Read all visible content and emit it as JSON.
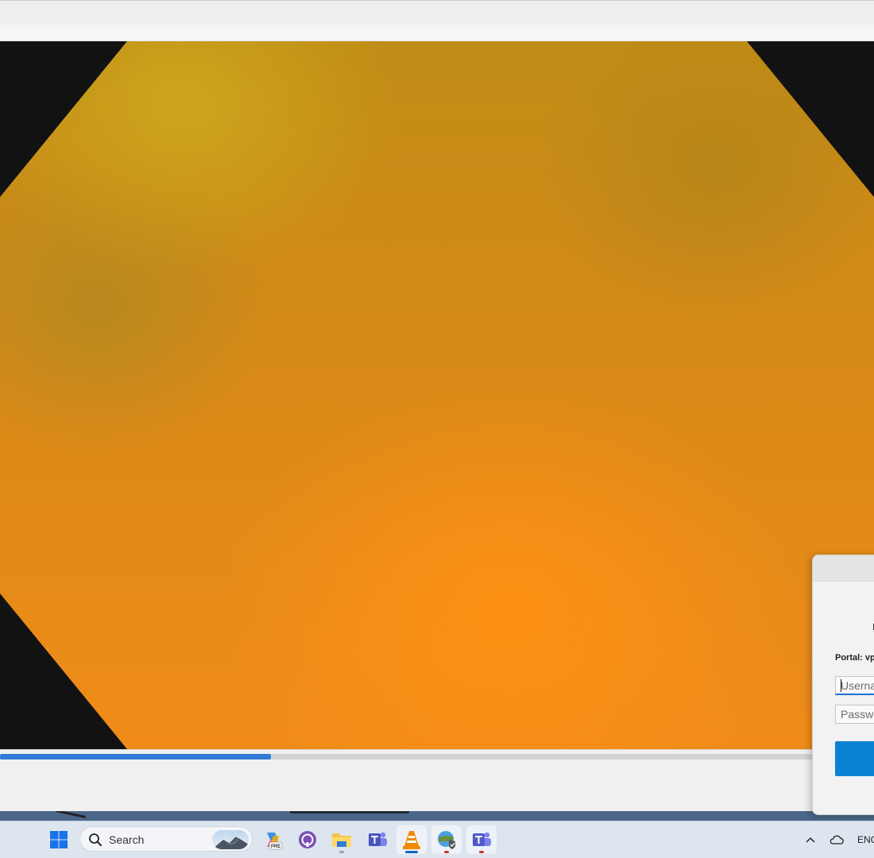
{
  "taskbar": {
    "search_label": "Search",
    "pinned": [
      {
        "name": "copilot",
        "badge": "PRE"
      },
      {
        "name": "github-desktop"
      },
      {
        "name": "file-explorer"
      },
      {
        "name": "teams-classic"
      },
      {
        "name": "vlc-media-player"
      },
      {
        "name": "vpn-client"
      },
      {
        "name": "microsoft-teams"
      }
    ],
    "tray": {
      "language": "ENG"
    }
  },
  "player": {
    "progress_fraction": 0.31,
    "colors": {
      "accent": "#2f7bd6",
      "video_orange": "#f08b19",
      "video_border": "#121212"
    }
  },
  "login_dialog": {
    "portal_label": "Portal: vp",
    "username_placeholder": "Userna",
    "password_placeholder": "Passwo",
    "button_color": "#0a82d4"
  }
}
